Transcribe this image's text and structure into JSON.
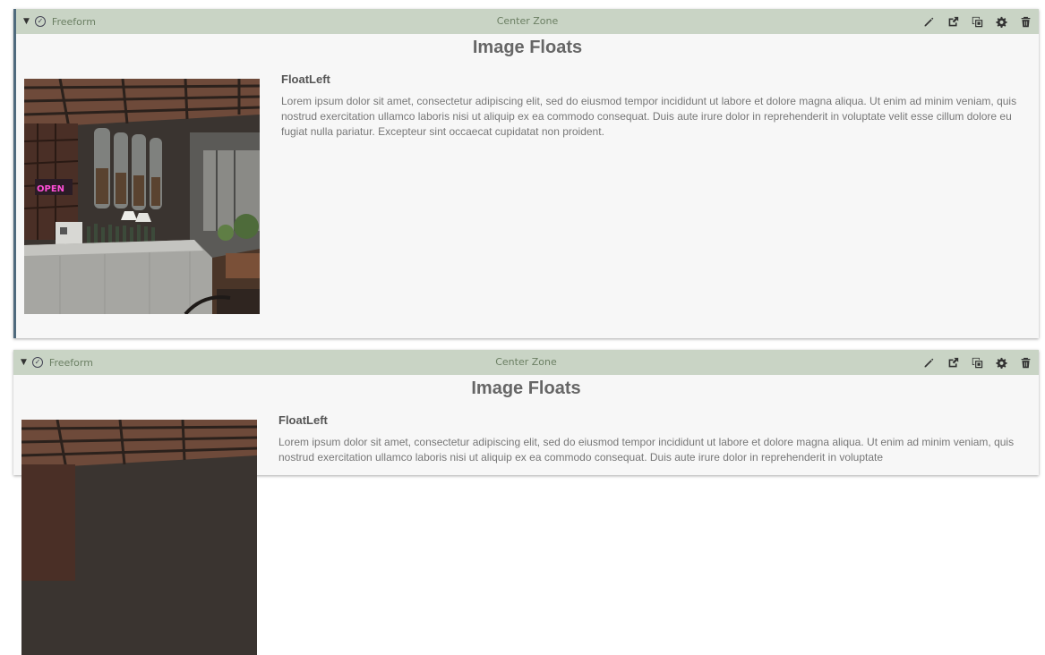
{
  "widgets": [
    {
      "toolbar": {
        "name": "Freeform",
        "zone": "Center Zone",
        "icons": [
          "caret-down-icon",
          "check-circle-icon",
          "pencil-icon",
          "share-icon",
          "copy-icon",
          "gear-icon",
          "trash-icon"
        ]
      },
      "heading": "Image Floats",
      "subheading": "FloatLeft",
      "paragraph": "Lorem ipsum dolor sit amet, consectetur adipiscing elit, sed do eiusmod tempor incididunt ut labore et dolore magna aliqua. Ut enim ad minim veniam, quis nostrud exercitation ullamco laboris nisi ut aliquip ex ea commodo consequat. Duis aute irure dolor in reprehenderit in voluptate velit esse cillum dolore eu fugiat nulla pariatur. Excepteur sint occaecat cupidatat non proident."
    },
    {
      "toolbar": {
        "name": "Freeform",
        "zone": "Center Zone",
        "icons": [
          "caret-down-icon",
          "check-circle-icon",
          "pencil-icon",
          "share-icon",
          "copy-icon",
          "gear-icon",
          "trash-icon"
        ]
      },
      "heading": "Image Floats",
      "subheading": "FloatLeft",
      "paragraph": "Lorem ipsum dolor sit amet, consectetur adipiscing elit, sed do eiusmod tempor incididunt ut labore et dolore magna aliqua. Ut enim ad minim veniam, quis nostrud exercitation ullamco laboris nisi ut aliquip ex ea commodo consequat. Duis aute irure dolor in reprehenderit in voluptate"
    }
  ],
  "colors": {
    "toolbar_bg": "#c9d4c5",
    "active_border": "#4f6a7d",
    "heading_text": "#666666",
    "body_text": "#777777"
  }
}
